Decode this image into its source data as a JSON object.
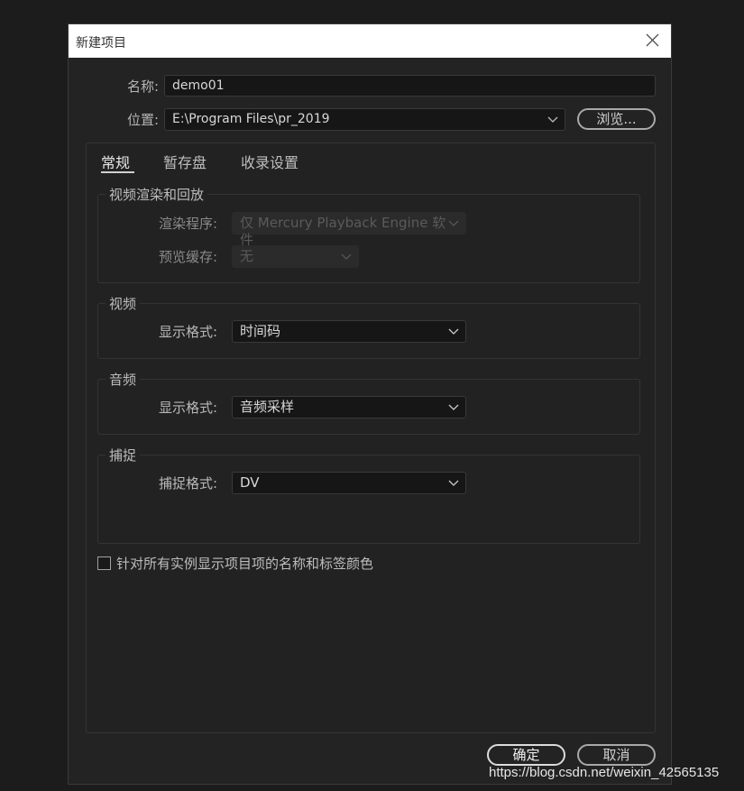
{
  "window": {
    "title": "新建项目"
  },
  "form": {
    "name_label": "名称:",
    "name_value": "demo01",
    "location_label": "位置:",
    "location_value": "E:\\Program Files\\pr_2019",
    "browse_label": "浏览..."
  },
  "tabs": [
    {
      "label": "常规",
      "active": true
    },
    {
      "label": "暂存盘",
      "active": false
    },
    {
      "label": "收录设置",
      "active": false
    }
  ],
  "groups": {
    "render": {
      "title": "视频渲染和回放",
      "renderer_label": "渲染程序:",
      "renderer_value": "仅 Mercury Playback Engine 软件",
      "preview_cache_label": "预览缓存:",
      "preview_cache_value": "无"
    },
    "video": {
      "title": "视频",
      "format_label": "显示格式:",
      "format_value": "时间码"
    },
    "audio": {
      "title": "音频",
      "format_label": "显示格式:",
      "format_value": "音频采样"
    },
    "capture": {
      "title": "捕捉",
      "format_label": "捕捉格式:",
      "format_value": "DV"
    }
  },
  "checkbox": {
    "label": "针对所有实例显示项目项的名称和标签颜色",
    "checked": false
  },
  "buttons": {
    "ok": "确定",
    "cancel": "取消"
  },
  "watermark": "https://blog.csdn.net/weixin_42565135",
  "icons": [
    "close-icon",
    "chevron-down-icon"
  ]
}
